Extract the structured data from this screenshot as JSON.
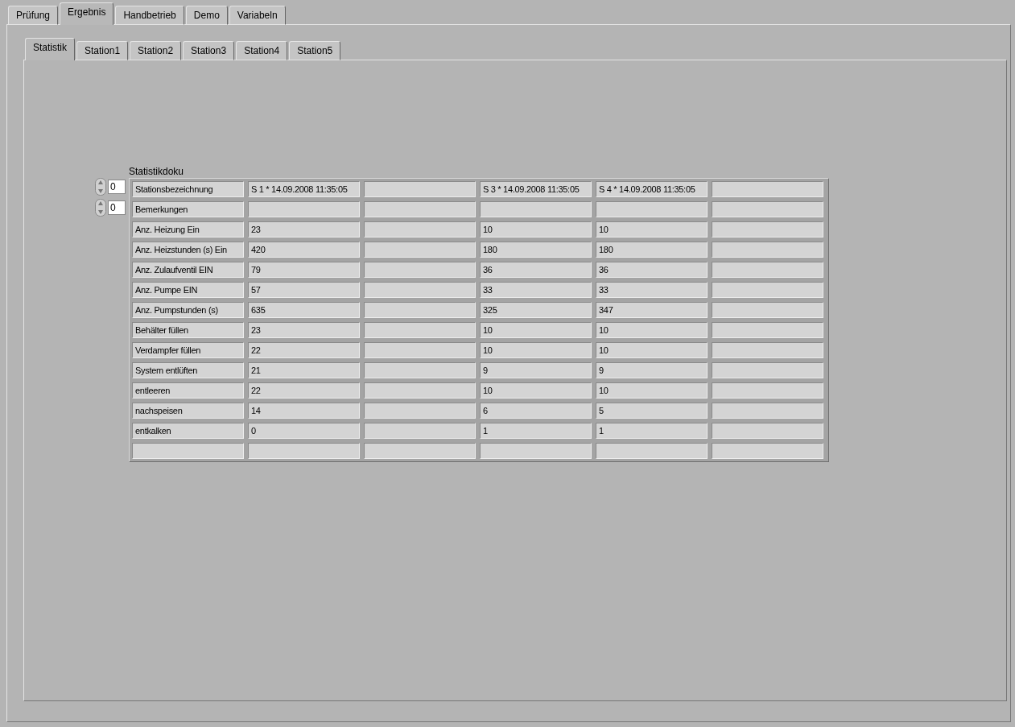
{
  "main_tabs": [
    {
      "label": "Prüfung",
      "selected": false
    },
    {
      "label": "Ergebnis",
      "selected": true
    },
    {
      "label": "Handbetrieb",
      "selected": false
    },
    {
      "label": "Demo",
      "selected": false
    },
    {
      "label": "Variabeln",
      "selected": false
    }
  ],
  "sub_tabs": [
    {
      "label": "Statistik",
      "selected": true
    },
    {
      "label": "Station1",
      "selected": false
    },
    {
      "label": "Station2",
      "selected": false
    },
    {
      "label": "Station3",
      "selected": false
    },
    {
      "label": "Station4",
      "selected": false
    },
    {
      "label": "Station5",
      "selected": false
    }
  ],
  "table": {
    "label": "Statistikdoku",
    "row_index": "0",
    "column_index": "0",
    "rows": [
      [
        "Stationsbezeichnung",
        "S 1 * 14.09.2008 11:35:05",
        null,
        "S 3 * 14.09.2008 11:35:05",
        "S 4 * 14.09.2008 11:35:05",
        null
      ],
      [
        "Bemerkungen",
        null,
        null,
        null,
        null,
        null
      ],
      [
        "Anz. Heizung Ein",
        "23",
        null,
        "10",
        "10",
        null
      ],
      [
        "Anz. Heizstunden (s) Ein",
        "420",
        null,
        "180",
        "180",
        null
      ],
      [
        "Anz. Zulaufventil EIN",
        "79",
        null,
        "36",
        "36",
        null
      ],
      [
        "Anz. Pumpe EIN",
        "57",
        null,
        "33",
        "33",
        null
      ],
      [
        "Anz. Pumpstunden (s)",
        "635",
        null,
        "325",
        "347",
        null
      ],
      [
        "Behälter füllen",
        "23",
        null,
        "10",
        "10",
        null
      ],
      [
        "Verdampfer füllen",
        "22",
        null,
        "10",
        "10",
        null
      ],
      [
        "System entlüften",
        "21",
        null,
        "9",
        "9",
        null
      ],
      [
        "entleeren",
        "22",
        null,
        "10",
        "10",
        null
      ],
      [
        "nachspeisen",
        "14",
        null,
        "6",
        "5",
        null
      ],
      [
        "entkalken",
        "0",
        null,
        "1",
        "1",
        null
      ],
      [
        null,
        null,
        null,
        null,
        null,
        null
      ]
    ]
  }
}
